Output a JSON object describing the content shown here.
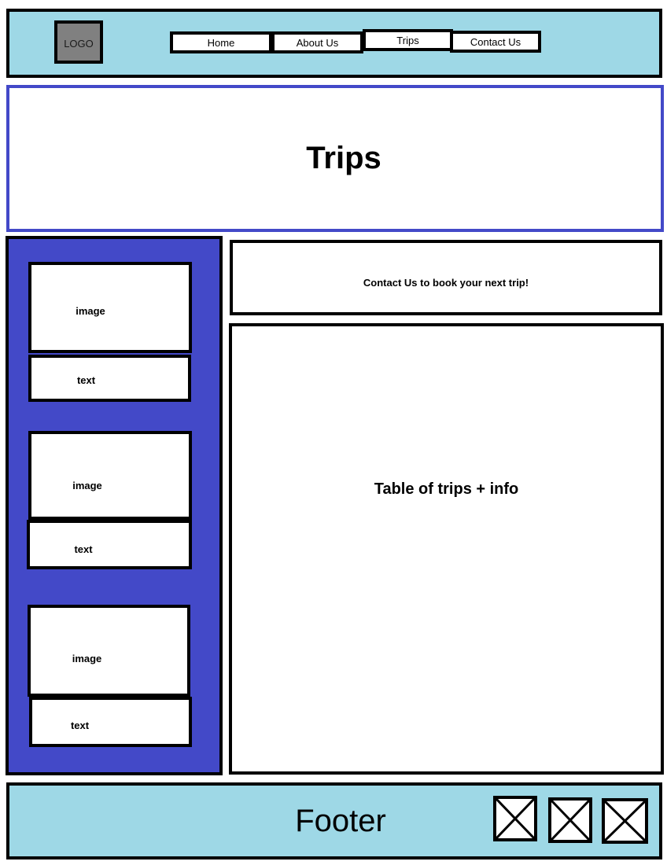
{
  "colors": {
    "header_bg": "#9ed8e6",
    "footer_bg": "#9ed8e6",
    "sidebar_bg": "#4349c8",
    "hero_border": "#4349c8",
    "logo_bg": "#808080"
  },
  "header": {
    "logo_text": "LOGO",
    "nav": {
      "home": "Home",
      "about": "About Us",
      "trips": "Trips",
      "contact": "Contact Us"
    }
  },
  "hero": {
    "title": "Trips"
  },
  "sidebar": {
    "cards": [
      {
        "image_label": "image",
        "text_label": "text"
      },
      {
        "image_label": "image",
        "text_label": "text"
      },
      {
        "image_label": "image",
        "text_label": "text"
      }
    ]
  },
  "main": {
    "cta_text": "Contact Us to book your next trip!",
    "table_label": "Table of trips + info"
  },
  "footer": {
    "label": "Footer",
    "social_icons": [
      "placeholder-x-icon",
      "placeholder-x-icon",
      "placeholder-x-icon"
    ]
  }
}
